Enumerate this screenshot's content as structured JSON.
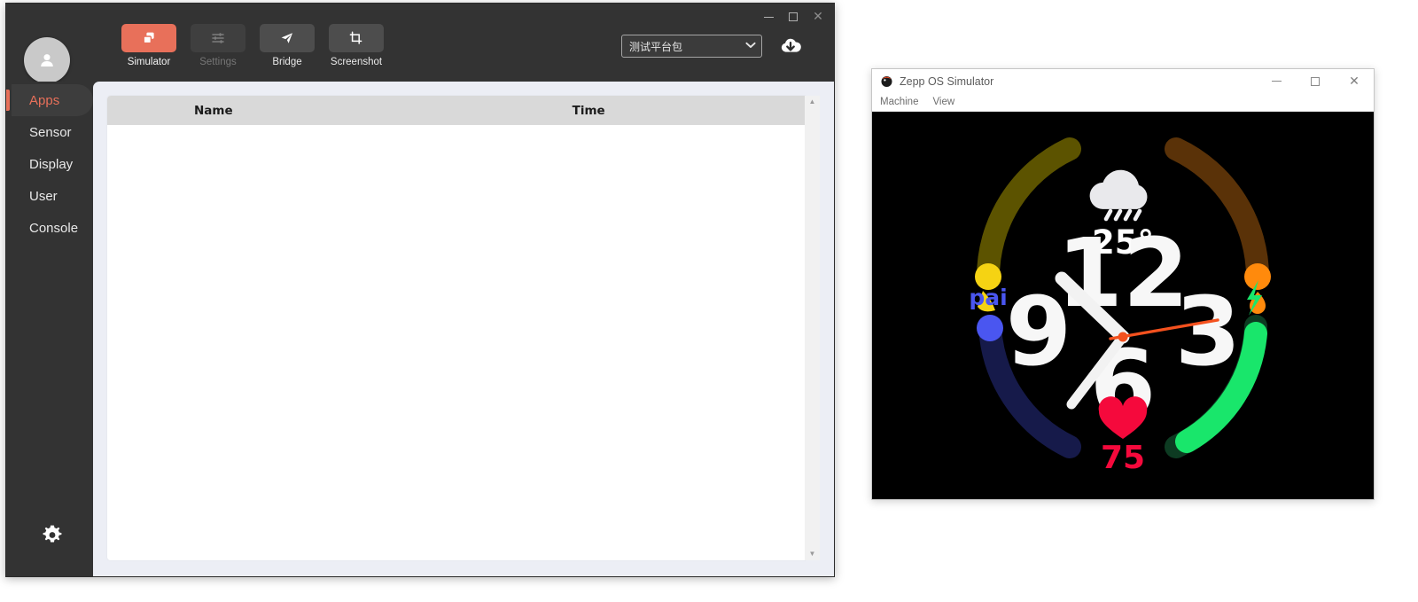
{
  "devtools": {
    "window_controls": {
      "minimize": "—",
      "maximize": "□",
      "close": "✕"
    },
    "avatar": "user-avatar",
    "toolbar": [
      {
        "label": "Simulator",
        "icon": "windows-copy-icon",
        "state": "active"
      },
      {
        "label": "Settings",
        "icon": "sliders-icon",
        "state": "disabled"
      },
      {
        "label": "Bridge",
        "icon": "paper-plane-icon",
        "state": "normal"
      },
      {
        "label": "Screenshot",
        "icon": "crop-icon",
        "state": "normal"
      }
    ],
    "package_select": {
      "value": "测试平台包",
      "chevron": "⌄"
    },
    "download_icon": "cloud-download-icon",
    "sidebar": {
      "items": [
        {
          "label": "Apps",
          "active": true
        },
        {
          "label": "Sensor",
          "active": false
        },
        {
          "label": "Display",
          "active": false
        },
        {
          "label": "User",
          "active": false
        },
        {
          "label": "Console",
          "active": false
        }
      ],
      "settings_icon": "gear-icon"
    },
    "table": {
      "columns": [
        "Name",
        "Time"
      ],
      "rows": []
    },
    "scrollbar": {
      "up": "▲",
      "down": "▼"
    },
    "accent_color": "#e8705a",
    "chrome_color": "#333333",
    "pane_color": "#eceef5"
  },
  "simulator": {
    "title": "Zepp OS Simulator",
    "app_icon": "zepp-logo-icon",
    "window_controls": {
      "minimize": "—",
      "maximize": "□",
      "close": "✕"
    },
    "menus": [
      "Machine",
      "View"
    ],
    "watchface": {
      "background": "#000000",
      "weather": {
        "icon": "rain-cloud-icon",
        "temperature": "25°",
        "color": "#ffffff"
      },
      "clock": {
        "numerals": [
          "12",
          "3",
          "6",
          "9"
        ],
        "hour_hand_color": "#f2f2f2",
        "minute_hand_color": "#f2f2f2",
        "second_hand_color": "#f4511e",
        "center_dot_color": "#f4511e",
        "hour_angle": -46,
        "minute_angle": 214,
        "second_angle": 82
      },
      "arcs": [
        {
          "name": "uv-arc",
          "label": "",
          "icon": "sun-icon",
          "track_color": "#5c5300",
          "fill_color": "#f5d313",
          "position": "top-left"
        },
        {
          "name": "calories-arc",
          "label": "",
          "icon": "flame-icon",
          "track_color": "#5a3208",
          "fill_color": "#ff8a0c",
          "position": "top-right"
        },
        {
          "name": "pai-arc",
          "label": "pai",
          "icon": "",
          "track_color": "#161a4a",
          "fill_color": "#4a56f0",
          "position": "bottom-left",
          "label_color": "#4a56f0"
        },
        {
          "name": "battery-arc",
          "label": "",
          "icon": "lightning-icon",
          "track_color": "#0d3b22",
          "fill_color": "#19e66b",
          "position": "bottom-right"
        }
      ],
      "heart_rate": {
        "icon": "heart-icon",
        "value": "75",
        "color": "#f5093c"
      }
    }
  }
}
